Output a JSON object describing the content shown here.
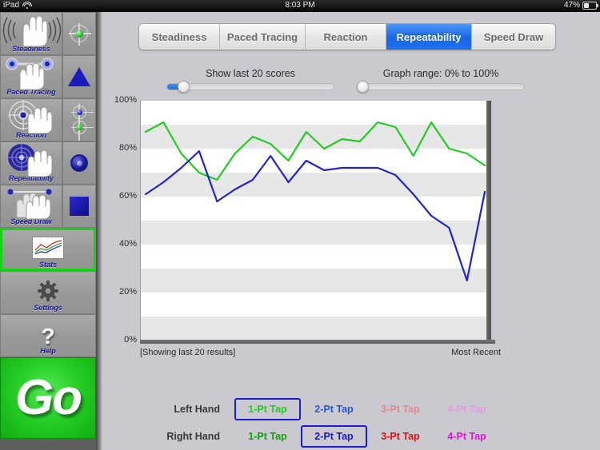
{
  "statusbar": {
    "device": "iPad",
    "wifi_icon": "wifi-icon",
    "time": "8:03 PM",
    "battery": "47%",
    "battery_icon": "battery-icon"
  },
  "sidebar": {
    "tests": [
      {
        "label": "Steadiness",
        "icon": "hand-steadiness-icon",
        "aux_icon": "target-green-icon",
        "selected": false
      },
      {
        "label": "Paced Tracing",
        "icon": "hand-paced-icon",
        "aux_icon": "triangle-blue-icon",
        "selected": false
      },
      {
        "label": "Reaction",
        "icon": "hand-reaction-icon",
        "aux_icon": "target-blue-green-icon",
        "selected": false
      },
      {
        "label": "Repeatability",
        "icon": "hand-repeat-icon",
        "aux_icon": "ring-blue-icon",
        "selected": false
      },
      {
        "label": "Speed Draw",
        "icon": "hand-speeddraw-icon",
        "aux_icon": "square-blue-icon",
        "selected": false
      }
    ],
    "tools": [
      {
        "label": "Stats",
        "icon": "chart-thumbnail-icon",
        "selected": true
      },
      {
        "label": "Settings",
        "icon": "gear-icon",
        "selected": false
      },
      {
        "label": "Help",
        "icon": "question-mark-icon",
        "selected": false
      }
    ],
    "go_label": "Go"
  },
  "tabs": [
    {
      "label": "Steadiness",
      "active": false
    },
    {
      "label": "Paced Tracing",
      "active": false
    },
    {
      "label": "Reaction",
      "active": false
    },
    {
      "label": "Repeatability",
      "active": true
    },
    {
      "label": "Speed Draw",
      "active": false
    }
  ],
  "sliders": [
    {
      "caption": "Show last 20 scores",
      "value": 20,
      "fill_pct": 10,
      "thumb_pct": 10
    },
    {
      "caption": "Graph range: 0% to 100%",
      "value": 0,
      "fill_pct": 0,
      "thumb_pct": 2
    }
  ],
  "chart_footer": {
    "left": "[Showing last 20 results]",
    "right": "Most Recent"
  },
  "legend": {
    "rows": [
      {
        "hand": "Left Hand",
        "cells": [
          {
            "label": "1-Pt Tap",
            "color": "#22cc22",
            "selected": true,
            "dim": false
          },
          {
            "label": "2-Pt Tap",
            "color": "#2a57d8",
            "selected": false,
            "dim": false
          },
          {
            "label": "3-Pt Tap",
            "color": "#e08a8a",
            "selected": false,
            "dim": true
          },
          {
            "label": "4-Pt Tap",
            "color": "#e59be5",
            "selected": false,
            "dim": true
          }
        ]
      },
      {
        "hand": "Right Hand",
        "cells": [
          {
            "label": "1-Pt Tap",
            "color": "#11a011",
            "selected": false,
            "dim": false
          },
          {
            "label": "2-Pt Tap",
            "color": "#1a1acc",
            "selected": true,
            "dim": false
          },
          {
            "label": "3-Pt Tap",
            "color": "#e01010",
            "selected": false,
            "dim": false
          },
          {
            "label": "4-Pt Tap",
            "color": "#e013e0",
            "selected": false,
            "dim": false
          }
        ]
      }
    ]
  },
  "chart_data": {
    "type": "line",
    "title": "",
    "xlabel": "",
    "ylabel": "",
    "ylim": [
      0,
      100
    ],
    "yticks": [
      100,
      80,
      60,
      40,
      20,
      0
    ],
    "ytick_labels": [
      "100%",
      "80%",
      "60%",
      "40%",
      "20%",
      "0%"
    ],
    "grid": "horizontal-bands",
    "legend_position": "below-chart",
    "x": [
      1,
      2,
      3,
      4,
      5,
      6,
      7,
      8,
      9,
      10,
      11,
      12,
      13,
      14,
      15,
      16,
      17,
      18,
      19,
      20
    ],
    "series": [
      {
        "name": "Left Hand 1-Pt Tap",
        "color": "#22cc22",
        "values": [
          87,
          91,
          78,
          70,
          67,
          78,
          85,
          82,
          75,
          87,
          80,
          84,
          83,
          91,
          89,
          77,
          91,
          80,
          78,
          73
        ]
      },
      {
        "name": "Right Hand 2-Pt Tap",
        "color": "#2424cc",
        "values": [
          61,
          66,
          72,
          79,
          58,
          63,
          67,
          77,
          66,
          75,
          71,
          72,
          72,
          72,
          69,
          61,
          52,
          47,
          25,
          62
        ]
      }
    ]
  }
}
